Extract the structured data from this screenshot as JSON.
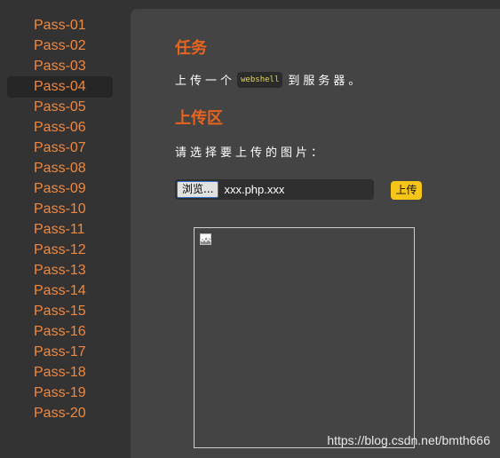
{
  "sidebar": {
    "items": [
      {
        "label": "Pass-01"
      },
      {
        "label": "Pass-02"
      },
      {
        "label": "Pass-03"
      },
      {
        "label": "Pass-04",
        "active": true
      },
      {
        "label": "Pass-05"
      },
      {
        "label": "Pass-06"
      },
      {
        "label": "Pass-07"
      },
      {
        "label": "Pass-08"
      },
      {
        "label": "Pass-09"
      },
      {
        "label": "Pass-10"
      },
      {
        "label": "Pass-11"
      },
      {
        "label": "Pass-12"
      },
      {
        "label": "Pass-13"
      },
      {
        "label": "Pass-14"
      },
      {
        "label": "Pass-15"
      },
      {
        "label": "Pass-16"
      },
      {
        "label": "Pass-17"
      },
      {
        "label": "Pass-18"
      },
      {
        "label": "Pass-19"
      },
      {
        "label": "Pass-20"
      }
    ]
  },
  "task": {
    "heading": "任务",
    "text_before": "上传一个",
    "code": "webshell",
    "text_after": "到服务器。"
  },
  "upload": {
    "heading": "上传区",
    "prompt": "请选择要上传的图片：",
    "browse_label": "浏览...",
    "file_name": "xxx.php.xxx",
    "submit_label": "上传"
  },
  "preview": {
    "icon": "broken-image-icon"
  },
  "watermark": "https://blog.csdn.net/bmth666",
  "colors": {
    "accent": "#e8641e",
    "link": "#f0883e",
    "button": "#f5c518",
    "panel": "#444444",
    "background": "#333333"
  }
}
